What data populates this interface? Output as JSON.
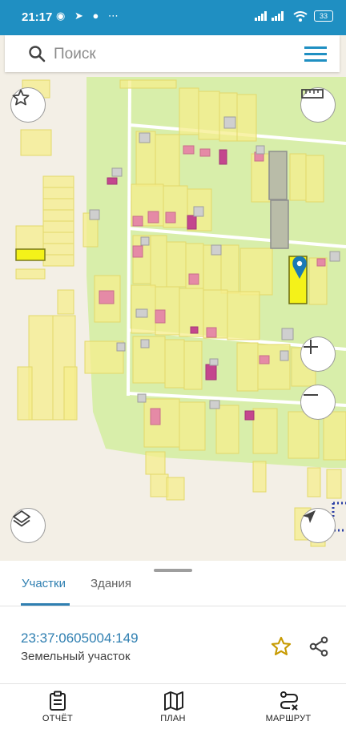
{
  "status_bar": {
    "time": "21:17",
    "battery": "33"
  },
  "search": {
    "placeholder": "Поиск"
  },
  "sheet": {
    "tabs": [
      {
        "label": "Участки",
        "active": true
      },
      {
        "label": "Здания",
        "active": false
      }
    ],
    "parcel": {
      "cadastral_number": "23:37:0605004:149",
      "type": "Земельный участок"
    }
  },
  "bottom_nav": {
    "items": [
      {
        "label": "ОТЧЁТ",
        "icon": "report-icon"
      },
      {
        "label": "ПЛАН",
        "icon": "map-plan-icon"
      },
      {
        "label": "МАРШРУТ",
        "icon": "route-icon"
      }
    ]
  },
  "colors": {
    "accent": "#2f7fb1",
    "status_bar": "#1f8fc2",
    "parcel_fill": "#f6ee8c",
    "selected_parcel": "#f4f219",
    "zone_fill": "#d8eeaa",
    "building_fill": "#e58aa6"
  }
}
